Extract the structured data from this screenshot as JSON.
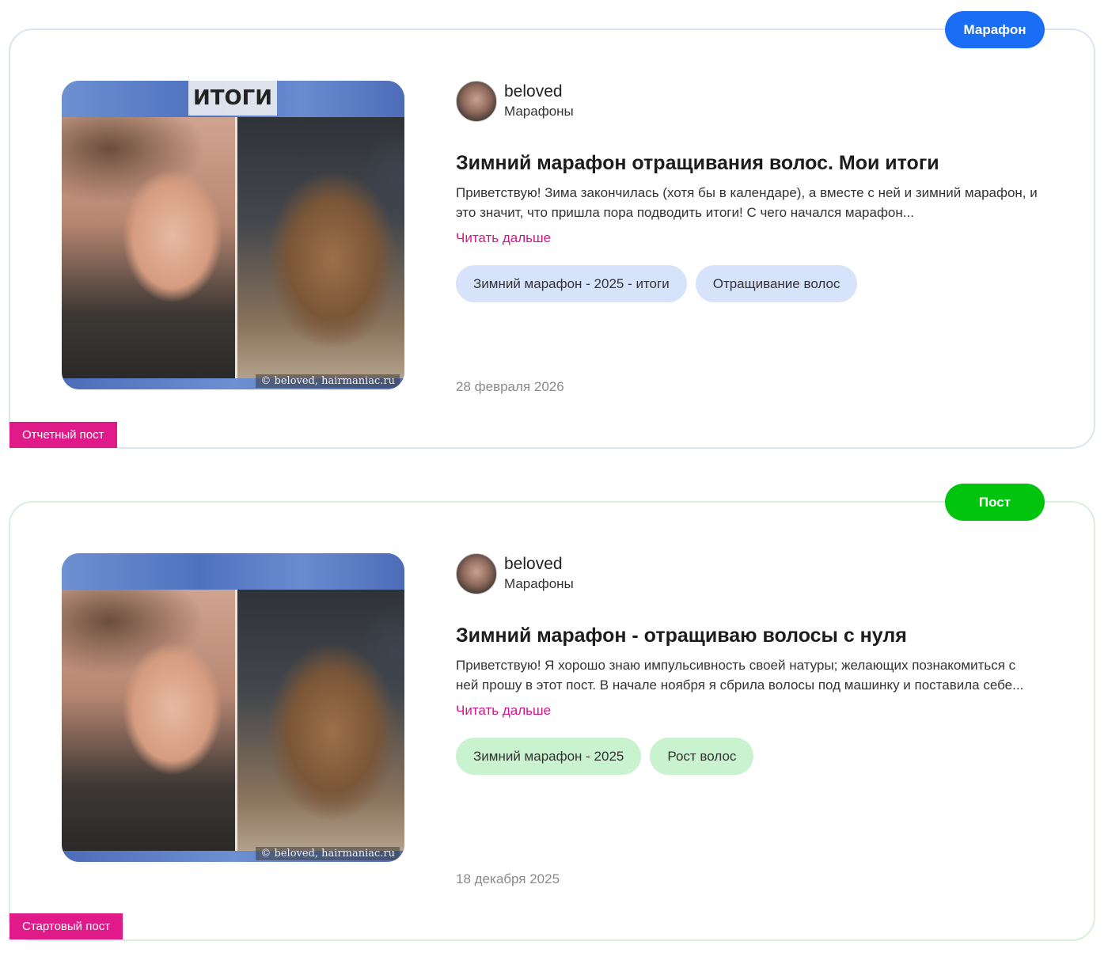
{
  "posts": [
    {
      "type_badge": "Марафон",
      "author": {
        "name": "beloved",
        "category": "Марафоны"
      },
      "title": "Зимний марафон отращивания волос. Мои итоги",
      "excerpt": "Приветствую! Зима закончилась (хотя бы в календаре), а вместе с ней и зимний марафон, и это значит, что пришла пора подводить итоги! С чего начался марафон...",
      "read_more": "Читать дальше",
      "tags": [
        "Зимний марафон - 2025 - итоги",
        "Отращивание волос"
      ],
      "date": "28 февраля 2026",
      "post_kind": "Отчетный пост",
      "image": {
        "overlay_text": "ИТОГИ",
        "copyright": "© beloved, hairmaniac.ru"
      },
      "accent_color": "#1a6ef5"
    },
    {
      "type_badge": "Пост",
      "author": {
        "name": "beloved",
        "category": "Марафоны"
      },
      "title": "Зимний марафон - отращиваю волосы с нуля",
      "excerpt": "Приветствую! Я хорошо знаю импульсивность своей натуры; желающих познакомиться с ней прошу в этот  пост. В начале ноября я сбрила волосы под машинку и поставила себе...",
      "read_more": "Читать дальше",
      "tags": [
        "Зимний марафон - 2025",
        "Рост волос"
      ],
      "date": "18 декабря 2025",
      "post_kind": "Стартовый пост",
      "image": {
        "copyright": "© beloved, hairmaniac.ru"
      },
      "accent_color": "#00c40d"
    }
  ],
  "colors": {
    "link": "#d4168a",
    "post_kind_badge": "#e01a88"
  }
}
